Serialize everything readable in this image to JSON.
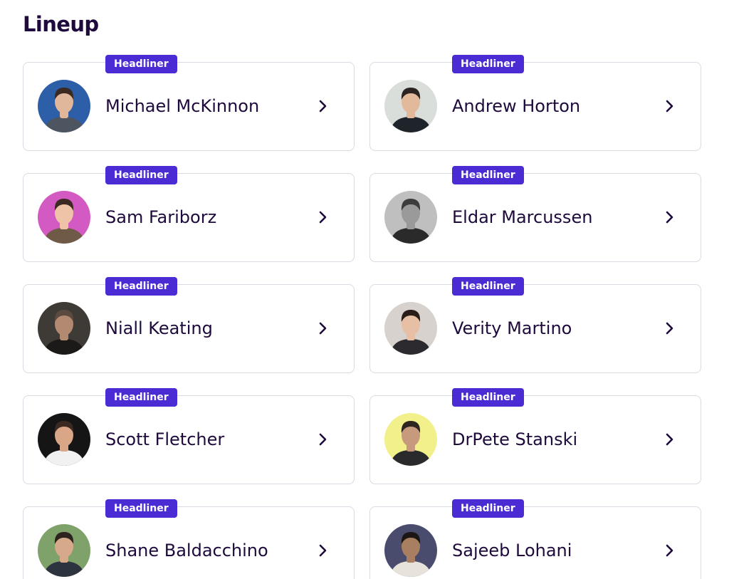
{
  "section": {
    "title": "Lineup"
  },
  "badge_color": "#4b2bd3",
  "speakers": [
    {
      "name": "Michael McKinnon",
      "badge": "Headliner",
      "avatar_icon": "avatar-photo-icon",
      "bg": "#2d5ea8",
      "skin": "#e0b79a",
      "hair": "#3a2a22",
      "shirt": "#4c5560"
    },
    {
      "name": "Andrew Horton",
      "badge": "Headliner",
      "avatar_icon": "avatar-photo-icon",
      "bg": "#d9dedb",
      "skin": "#e3b99b",
      "hair": "#2b2420",
      "shirt": "#1f242b"
    },
    {
      "name": "Sam Fariborz",
      "badge": "Headliner",
      "avatar_icon": "avatar-photo-icon",
      "bg": "#d25ac2",
      "skin": "#eec3a8",
      "hair": "#3b2a22",
      "shirt": "#6e5a47"
    },
    {
      "name": "Eldar Marcussen",
      "badge": "Headliner",
      "avatar_icon": "avatar-photo-icon",
      "bg": "#bfbfbf",
      "skin": "#9a9a9a",
      "hair": "#3d3d3d",
      "shirt": "#2a2a2a"
    },
    {
      "name": "Niall Keating",
      "badge": "Headliner",
      "avatar_icon": "avatar-photo-icon",
      "bg": "#3e3a36",
      "skin": "#b28a72",
      "hair": "#5b4a3f",
      "shirt": "#1b1a18"
    },
    {
      "name": "Verity Martino",
      "badge": "Headliner",
      "avatar_icon": "avatar-photo-icon",
      "bg": "#d7d2ce",
      "skin": "#e6bfa5",
      "hair": "#2a1d18",
      "shirt": "#2c2a2e"
    },
    {
      "name": "Scott Fletcher",
      "badge": "Headliner",
      "avatar_icon": "avatar-photo-icon",
      "bg": "#151515",
      "skin": "#d9a787",
      "hair": "#3a2a22",
      "shirt": "#f1f1f1"
    },
    {
      "name": "DrPete Stanski",
      "badge": "Headliner",
      "avatar_icon": "avatar-photo-icon",
      "bg": "#f2f08a",
      "skin": "#c79a7d",
      "hair": "#2e2520",
      "shirt": "#2a2a2c"
    },
    {
      "name": "Shane Baldacchino",
      "badge": "Headliner",
      "avatar_icon": "avatar-photo-icon",
      "bg": "#7fa26a",
      "skin": "#d7a98b",
      "hair": "#2d231e",
      "shirt": "#2d3440"
    },
    {
      "name": "Sajeeb Lohani",
      "badge": "Headliner",
      "avatar_icon": "avatar-photo-icon",
      "bg": "#4a4c6e",
      "skin": "#a97f62",
      "hair": "#1c1714",
      "shirt": "#e8e3da"
    }
  ]
}
